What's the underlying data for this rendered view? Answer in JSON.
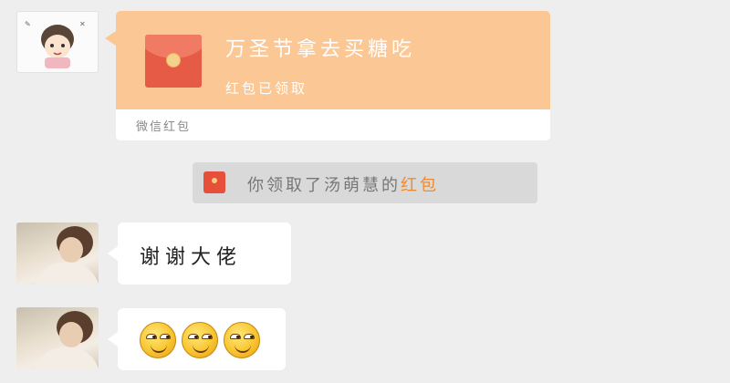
{
  "red_packet": {
    "title": "万圣节拿去买糖吃",
    "status": "红包已领取",
    "source": "微信红包"
  },
  "system_notice": {
    "prefix": "你领取了汤萌慧的",
    "highlight": "红包",
    "highlight_color": "#f08a2c"
  },
  "messages": [
    {
      "text": "谢谢大佬"
    },
    {
      "emojis": [
        "smirk-emoji",
        "smirk-emoji",
        "smirk-emoji"
      ]
    }
  ],
  "colors": {
    "background": "#eeeeee",
    "red_packet_orange": "#fbc794",
    "envelope_red": "#e65b45",
    "bubble_white": "#ffffff"
  }
}
